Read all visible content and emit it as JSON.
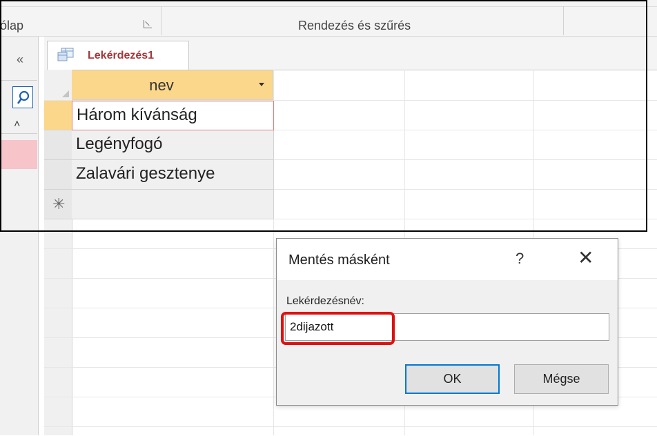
{
  "ribbon": {
    "group_left_label": "ólap",
    "group_right_label": "Rendezés és szűrés"
  },
  "nav": {
    "collapse_glyph": "«",
    "scroll_up_glyph": "⌃"
  },
  "document_tab": {
    "label": "Lekérdezés1"
  },
  "datasheet": {
    "column_header": "nev",
    "rows": [
      "Három kívánság",
      "Legényfogó",
      "Zalavári gesztenye"
    ],
    "new_row_glyph": "✳"
  },
  "dialog": {
    "title": "Mentés másként",
    "help_glyph": "?",
    "close_glyph": "✕",
    "field_label": "Lekérdezésnév:",
    "field_value": "2dijazott",
    "ok_label": "OK",
    "cancel_label": "Mégse"
  },
  "colors": {
    "header_accent": "#fbd78b",
    "tab_text": "#a4373a",
    "highlight": "#e01010",
    "focus_button": "#0078d7"
  }
}
